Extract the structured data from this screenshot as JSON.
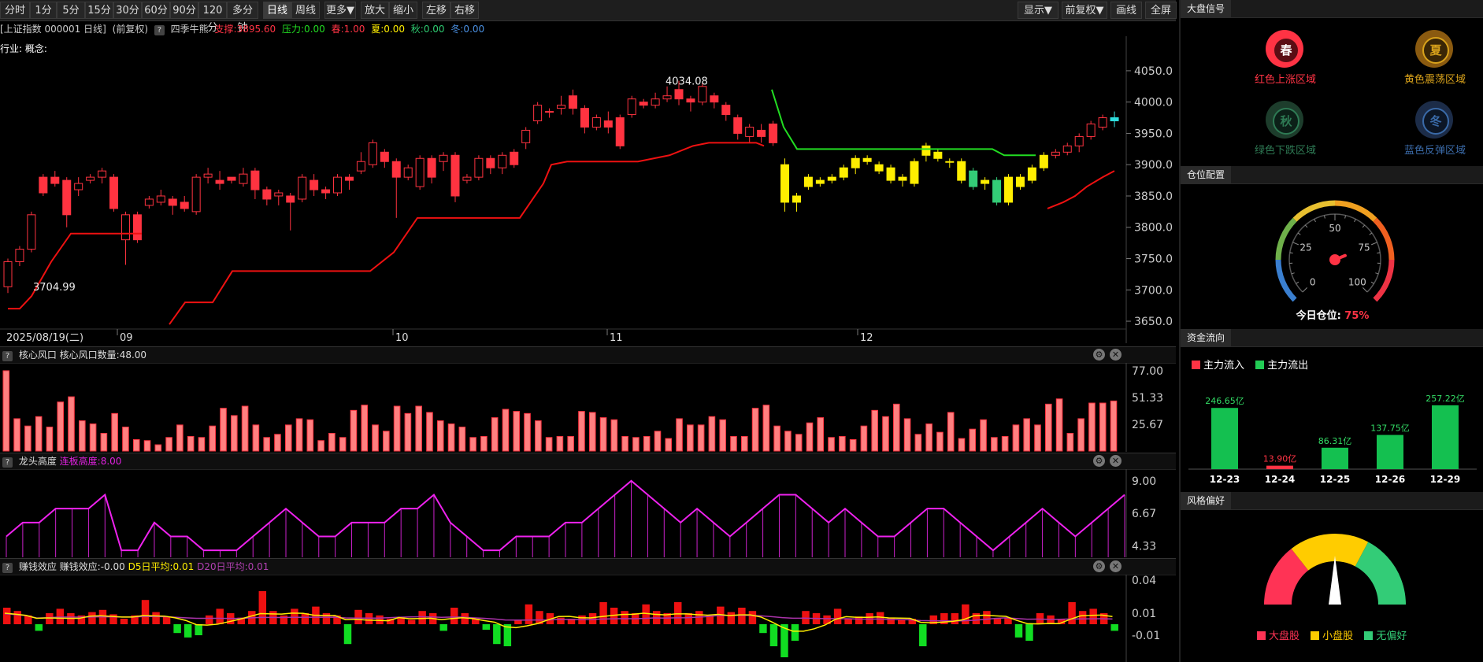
{
  "toolbar": {
    "buttons": [
      "分时",
      "1分",
      "5分",
      "15分",
      "30分",
      "60分",
      "90分",
      "120分",
      "多分钟",
      "日线",
      "周线",
      "更多▼",
      "放大",
      "缩小",
      "左移",
      "右移"
    ],
    "active": "日线",
    "right_buttons": [
      "显示▼",
      "前复权▼",
      "画线",
      "全屏"
    ]
  },
  "info": {
    "security": "[上证指数 000001 日线]",
    "adjust": "(前复权)",
    "indicator": "四季牛熊",
    "support": "支撑:3895.60",
    "pressure": "压力:0.00",
    "spring": "春:1.00",
    "summer": "夏:0.00",
    "autumn": "秋:0.00",
    "winter": "冬:0.00",
    "industry": "行业:",
    "concept": "概念:"
  },
  "main_chart": {
    "price_ticks": [
      "4050.0",
      "4000.0",
      "3950.0",
      "3900.0",
      "3850.0",
      "3800.0",
      "3750.0",
      "3700.0",
      "3650.0"
    ],
    "high_label": "4034.08",
    "low_label": "3704.99",
    "date_labels": [
      "2025/08/19(二)",
      "09",
      "10",
      "11",
      "12"
    ]
  },
  "panels": {
    "p1": {
      "title": "核心风口",
      "value": "核心风口数量:48.00",
      "ticks": [
        "77.00",
        "51.33",
        "25.67"
      ]
    },
    "p2": {
      "title": "龙头高度",
      "value": "连板高度:8.00",
      "ticks": [
        "9.00",
        "6.67",
        "4.33"
      ]
    },
    "p3": {
      "title": "赚钱效应",
      "value": "赚钱效应:-0.00",
      "d5": "D5日平均:0.01",
      "d20": "D20日平均:0.01",
      "ticks": [
        "0.04",
        "0.01",
        "-0.01"
      ]
    }
  },
  "right_panel": {
    "signal_title": "大盘信号",
    "seasons": [
      {
        "glyph": "春",
        "label": "红色上涨区域",
        "color": "#ff3344"
      },
      {
        "glyph": "夏",
        "label": "黄色震荡区域",
        "color": "#d9a21b"
      },
      {
        "glyph": "秋",
        "label": "绿色下跌区域",
        "color": "#2e7a54"
      },
      {
        "glyph": "冬",
        "label": "蓝色反弹区域",
        "color": "#3a6aa8"
      }
    ],
    "position_title": "仓位配置",
    "gauge_ticks": [
      "0",
      "25",
      "50",
      "75",
      "100"
    ],
    "today_label": "今日仓位:",
    "today_value": "75%",
    "gauge_level": 75,
    "fund_title": "资金流向",
    "fund_legend_in": "主力流入",
    "fund_legend_out": "主力流出",
    "fund_bars": [
      {
        "date": "12-23",
        "label": "246.65亿",
        "value": 246.65,
        "type": "out"
      },
      {
        "date": "12-24",
        "label": "13.90亿",
        "value": 13.9,
        "type": "in"
      },
      {
        "date": "12-25",
        "label": "86.31亿",
        "value": 86.31,
        "type": "out"
      },
      {
        "date": "12-26",
        "label": "137.75亿",
        "value": 137.75,
        "type": "out"
      },
      {
        "date": "12-29",
        "label": "257.22亿",
        "value": 257.22,
        "type": "out"
      }
    ],
    "style_title": "风格偏好",
    "style_legend": [
      "大盘股",
      "小盘股",
      "无偏好"
    ]
  },
  "chart_data": {
    "type": "candlestick",
    "ylim": [
      3640,
      4070
    ],
    "candles": [
      [
        3705,
        3745,
        3695,
        3750
      ],
      [
        3745,
        3765,
        3738,
        3770
      ],
      [
        3765,
        3820,
        3760,
        3825
      ],
      [
        3880,
        3855,
        3850,
        3885
      ],
      [
        3880,
        3870,
        3865,
        3890
      ],
      [
        3875,
        3820,
        3800,
        3880
      ],
      [
        3860,
        3870,
        3850,
        3880
      ],
      [
        3875,
        3880,
        3870,
        3885
      ],
      [
        3880,
        3890,
        3870,
        3895
      ],
      [
        3880,
        3830,
        3825,
        3885
      ],
      [
        3780,
        3820,
        3740,
        3825
      ],
      [
        3820,
        3780,
        3775,
        3825
      ],
      [
        3835,
        3845,
        3830,
        3850
      ],
      [
        3840,
        3850,
        3835,
        3860
      ],
      [
        3845,
        3835,
        3820,
        3850
      ],
      [
        3840,
        3830,
        3825,
        3850
      ],
      [
        3825,
        3880,
        3820,
        3885
      ],
      [
        3880,
        3885,
        3870,
        3895
      ],
      [
        3875,
        3870,
        3860,
        3890
      ],
      [
        3880,
        3875,
        3870,
        3880
      ],
      [
        3870,
        3885,
        3865,
        3895
      ],
      [
        3890,
        3860,
        3845,
        3895
      ],
      [
        3860,
        3845,
        3835,
        3865
      ],
      [
        3850,
        3855,
        3835,
        3860
      ],
      [
        3850,
        3840,
        3795,
        3855
      ],
      [
        3845,
        3880,
        3840,
        3885
      ],
      [
        3875,
        3860,
        3850,
        3885
      ],
      [
        3860,
        3855,
        3845,
        3865
      ],
      [
        3855,
        3880,
        3850,
        3885
      ],
      [
        3880,
        3875,
        3860,
        3885
      ],
      [
        3890,
        3905,
        3885,
        3920
      ],
      [
        3900,
        3935,
        3895,
        3940
      ],
      [
        3920,
        3905,
        3895,
        3925
      ],
      [
        3905,
        3880,
        3815,
        3910
      ],
      [
        3880,
        3895,
        3875,
        3900
      ],
      [
        3865,
        3910,
        3860,
        3915
      ],
      [
        3910,
        3880,
        3870,
        3915
      ],
      [
        3905,
        3915,
        3890,
        3920
      ],
      [
        3915,
        3850,
        3840,
        3920
      ],
      [
        3875,
        3880,
        3870,
        3885
      ],
      [
        3880,
        3910,
        3875,
        3915
      ],
      [
        3910,
        3895,
        3885,
        3915
      ],
      [
        3895,
        3915,
        3885,
        3920
      ],
      [
        3920,
        3900,
        3895,
        3925
      ],
      [
        3935,
        3955,
        3925,
        3960
      ],
      [
        3970,
        3995,
        3965,
        4000
      ],
      [
        3985,
        3985,
        3975,
        3990
      ],
      [
        3990,
        3995,
        3980,
        4010
      ],
      [
        4010,
        3990,
        3980,
        4020
      ],
      [
        3990,
        3960,
        3950,
        3995
      ],
      [
        3960,
        3975,
        3955,
        3980
      ],
      [
        3970,
        3960,
        3950,
        3985
      ],
      [
        3975,
        3930,
        3925,
        3980
      ],
      [
        3980,
        4005,
        3975,
        4010
      ],
      [
        4000,
        3995,
        3990,
        4005
      ],
      [
        3995,
        4005,
        3990,
        4015
      ],
      [
        4005,
        4010,
        4000,
        4025
      ],
      [
        4020,
        4005,
        3995,
        4034
      ],
      [
        4005,
        4000,
        3985,
        4010
      ],
      [
        4000,
        4025,
        3995,
        4030
      ],
      [
        4010,
        4000,
        3990,
        4015
      ],
      [
        3995,
        3980,
        3970,
        4000
      ],
      [
        3975,
        3950,
        3940,
        3980
      ],
      [
        3945,
        3960,
        3935,
        3965
      ],
      [
        3955,
        3945,
        3935,
        3965
      ],
      [
        3965,
        3935,
        3930,
        3970
      ],
      [
        3900,
        3840,
        3825,
        3910
      ],
      [
        3840,
        3850,
        3825,
        3855
      ],
      [
        3865,
        3880,
        3860,
        3885
      ],
      [
        3870,
        3875,
        3865,
        3880
      ],
      [
        3875,
        3880,
        3870,
        3885
      ],
      [
        3880,
        3895,
        3875,
        3900
      ],
      [
        3895,
        3910,
        3885,
        3915
      ],
      [
        3910,
        3905,
        3900,
        3915
      ],
      [
        3900,
        3890,
        3885,
        3905
      ],
      [
        3895,
        3875,
        3870,
        3900
      ],
      [
        3875,
        3880,
        3865,
        3885
      ],
      [
        3870,
        3905,
        3865,
        3910
      ],
      [
        3915,
        3930,
        3905,
        3935
      ],
      [
        3920,
        3910,
        3905,
        3925
      ],
      [
        3905,
        3905,
        3895,
        3910
      ],
      [
        3905,
        3875,
        3870,
        3910
      ],
      [
        3865,
        3890,
        3860,
        3895
      ],
      [
        3875,
        3870,
        3860,
        3880
      ],
      [
        3840,
        3875,
        3835,
        3880
      ],
      [
        3840,
        3880,
        3835,
        3885
      ],
      [
        3880,
        3865,
        3860,
        3885
      ],
      [
        3875,
        3895,
        3870,
        3900
      ],
      [
        3895,
        3915,
        3890,
        3920
      ],
      [
        3915,
        3920,
        3910,
        3925
      ],
      [
        3920,
        3930,
        3915,
        3935
      ],
      [
        3930,
        3945,
        3920,
        3950
      ],
      [
        3945,
        3965,
        3940,
        3970
      ],
      [
        3960,
        3975,
        3955,
        3980
      ],
      [
        3975,
        3970,
        3960,
        3985
      ]
    ],
    "support_line": [
      3670,
      3670,
      3690,
      3740,
      3790,
      3790,
      3790,
      3790,
      3790,
      3790,
      3790,
      3790,
      3790,
      3790
    ],
    "pressure_line_green": [
      4020,
      3960,
      3925,
      3925,
      3925,
      3925,
      3925,
      3925,
      3925,
      3925,
      3925,
      3925,
      3925,
      3925,
      3925,
      3925,
      3925,
      3915,
      3915,
      3915,
      3915
    ],
    "core_wind": [
      77,
      31,
      24,
      33,
      23,
      47,
      52,
      29,
      26,
      17,
      36,
      23,
      11,
      10,
      6,
      13,
      25,
      14,
      13,
      24,
      41,
      34,
      43,
      25,
      13,
      16,
      25,
      31,
      30,
      10,
      17,
      13,
      39,
      44,
      25,
      19,
      43,
      36,
      43,
      37,
      29,
      26,
      23,
      13,
      14,
      32,
      40,
      38,
      36,
      29,
      13,
      14,
      14,
      38,
      37,
      32,
      30,
      14,
      13,
      14,
      19,
      12,
      31,
      25,
      25,
      33,
      30,
      14,
      14,
      41,
      44,
      24,
      19,
      16,
      27,
      32,
      13,
      14,
      11,
      24,
      39,
      33,
      45,
      31,
      16,
      26,
      18,
      37,
      12,
      21,
      30,
      13,
      14,
      25,
      31,
      25,
      45,
      50,
      17,
      31,
      46,
      46,
      48
    ],
    "dragon_height": [
      5,
      6,
      6,
      7,
      7,
      7,
      8,
      4,
      4,
      6,
      5,
      5,
      4,
      4,
      4,
      5,
      6,
      7,
      6,
      5,
      5,
      6,
      6,
      6,
      7,
      7,
      8,
      6,
      5,
      4,
      4,
      5,
      5,
      5,
      6,
      6,
      7,
      8,
      9,
      8,
      7,
      6,
      7,
      6,
      5,
      6,
      7,
      8,
      8,
      7,
      6,
      7,
      6,
      5,
      5,
      6,
      7,
      7,
      6,
      5,
      4,
      5,
      6,
      7,
      6,
      5,
      6,
      7,
      8
    ],
    "money_effect": [
      0.015,
      0.012,
      0.008,
      -0.006,
      0.01,
      0.014,
      0.01,
      0.008,
      0.011,
      0.013,
      0.009,
      0.005,
      0.008,
      0.022,
      0.011,
      0.007,
      -0.008,
      -0.012,
      -0.01,
      0.008,
      0.014,
      0.01,
      0.006,
      0.012,
      0.03,
      0.012,
      0.008,
      0.014,
      0.01,
      0.016,
      0.01,
      0.008,
      -0.018,
      0.013,
      0.01,
      0.008,
      0.005,
      0.006,
      0.004,
      0.012,
      0.01,
      -0.006,
      0.015,
      0.01,
      0.005,
      -0.005,
      -0.018,
      -0.02,
      0.004,
      0.018,
      0.012,
      0.01,
      0.006,
      0.005,
      0.008,
      0.01,
      0.02,
      0.015,
      0.012,
      0.01,
      0.018,
      0.012,
      0.01,
      0.02,
      0.01,
      0.012,
      0.008,
      0.016,
      0.011,
      0.015,
      0.012,
      -0.008,
      -0.02,
      -0.03,
      -0.015,
      0.012,
      0.01,
      0.008,
      0.014,
      0.005,
      0.007,
      0.01,
      0.011,
      0.006,
      0.004,
      0.005,
      -0.02,
      0.008,
      0.01,
      0.01,
      0.018,
      0.01,
      0.012,
      0.005,
      0.006,
      -0.012,
      -0.015,
      0.01,
      0.008,
      0.005,
      0.02,
      0.012,
      0.014,
      0.01,
      -0.006
    ]
  }
}
